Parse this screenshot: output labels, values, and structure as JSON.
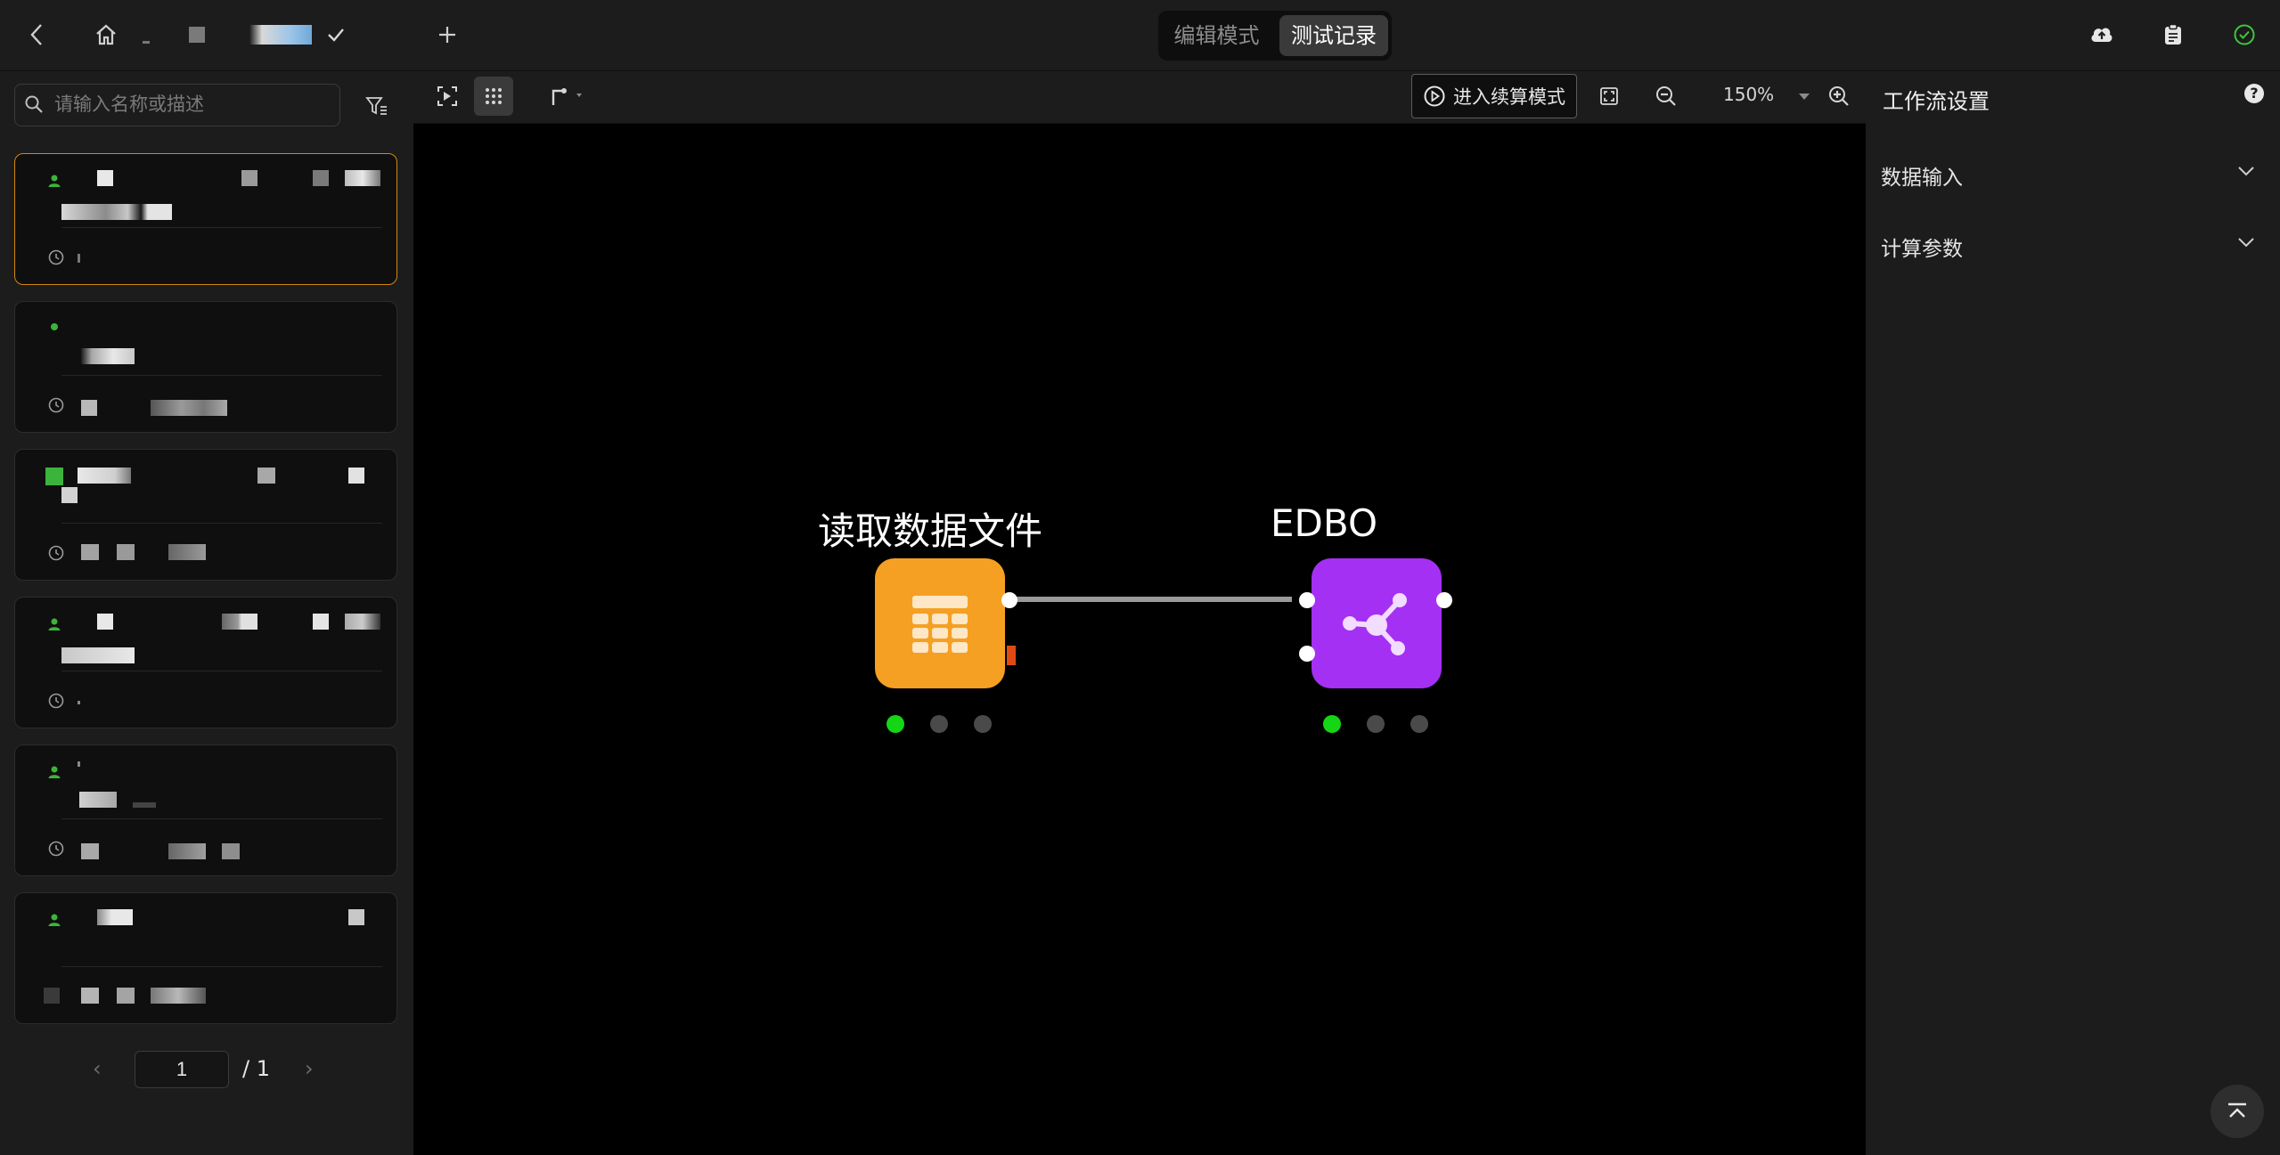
{
  "header": {
    "modes": {
      "edit": "编辑模式",
      "test": "测试记录"
    }
  },
  "sidebar": {
    "search_placeholder": "请输入名称或描述",
    "pagination": {
      "current": "1",
      "total": "/ 1"
    }
  },
  "canvas_toolbar": {
    "resume_label": "进入续算模式",
    "zoom": "150%"
  },
  "workflow": {
    "nodes": [
      {
        "label": "读取数据文件",
        "color": "#f5a023",
        "icon": "table-grid-icon"
      },
      {
        "label": "EDBO",
        "color": "#a430f4",
        "icon": "share-network-icon"
      }
    ],
    "status_colors": {
      "active": "#14d614",
      "inactive": "#4a4a4a"
    }
  },
  "right_panel": {
    "title": "工作流设置",
    "sections": [
      "数据输入",
      "计算参数"
    ]
  },
  "colors": {
    "accent_border": "#d4870f",
    "success": "#3cc83c",
    "user_icon": "#3cb43c"
  }
}
